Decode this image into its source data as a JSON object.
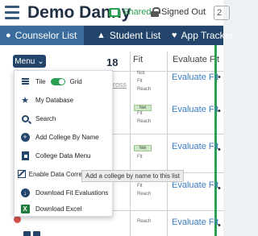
{
  "header": {
    "title": "Demo Danny",
    "shared_label": "Shared",
    "signed_out_label": "Signed Out",
    "search_stub": "2"
  },
  "tabs": [
    {
      "label": "Counselor List",
      "icon": "person-icon",
      "active": true
    },
    {
      "label": "Student List",
      "icon": "graduation-cap-icon",
      "active": false
    },
    {
      "label": "App Tracker",
      "icon": "heart-icon",
      "active": false
    }
  ],
  "table": {
    "count": "18",
    "fit_header": "Fit",
    "evaluate_header": "Evaluate Fit",
    "cross_label": "ross",
    "eval_link": "Evaluate Fit",
    "fit_levels": [
      "Not",
      "Fit",
      "Reach"
    ],
    "fit_badge": "Not"
  },
  "menu": {
    "button_label": "Menu",
    "items": [
      {
        "label": "Tile",
        "icon": "list-icon"
      },
      {
        "label": "Grid",
        "icon": "toggle-icon"
      },
      {
        "label": "My Database",
        "icon": "star-icon"
      },
      {
        "label": "Search",
        "icon": "search-icon"
      },
      {
        "label": "Add College By Name",
        "icon": "plus-circle-icon"
      },
      {
        "label": "College Data Menu",
        "icon": "document-icon"
      },
      {
        "label": "Enable Data Correction Mode",
        "icon": "edit-icon"
      },
      {
        "label": "Download Fit Evaluations",
        "icon": "download-icon"
      },
      {
        "label": "Download Excel",
        "icon": "excel-icon"
      }
    ]
  },
  "tooltip": "Add a college by name to this list",
  "colors": {
    "navy": "#23456b",
    "active_tab": "#3a6d9e",
    "green": "#2aa052",
    "link": "#3a7cc2"
  }
}
